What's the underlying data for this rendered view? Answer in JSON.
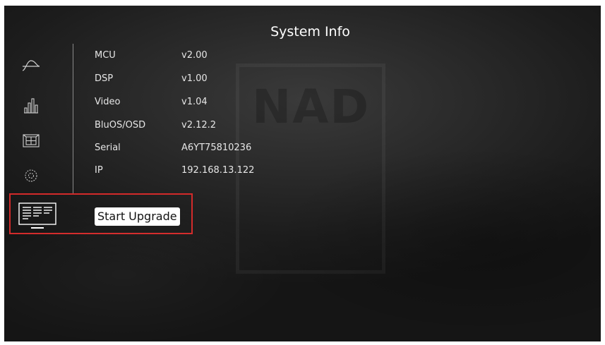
{
  "header": {
    "title": "System Info"
  },
  "watermark": {
    "brand": "NAD"
  },
  "sidebar": {
    "icons": [
      "waveform-icon",
      "equalizer-icon",
      "speaker-layout-icon",
      "settings-gear-icon",
      "monitor-info-icon"
    ]
  },
  "info": {
    "rows": [
      {
        "label": "MCU",
        "value": "v2.00"
      },
      {
        "label": "DSP",
        "value": "v1.00"
      },
      {
        "label": "Video",
        "value": "v1.04"
      },
      {
        "label": "BluOS/OSD",
        "value": "v2.12.2"
      },
      {
        "label": "Serial",
        "value": "A6YT75810236"
      },
      {
        "label": "IP",
        "value": "192.168.13.122"
      }
    ]
  },
  "actions": {
    "upgrade_label": "Start Upgrade"
  },
  "colors": {
    "highlight": "#d32a2a",
    "background": "#2a2a2a",
    "text": "#e6e6e6"
  }
}
